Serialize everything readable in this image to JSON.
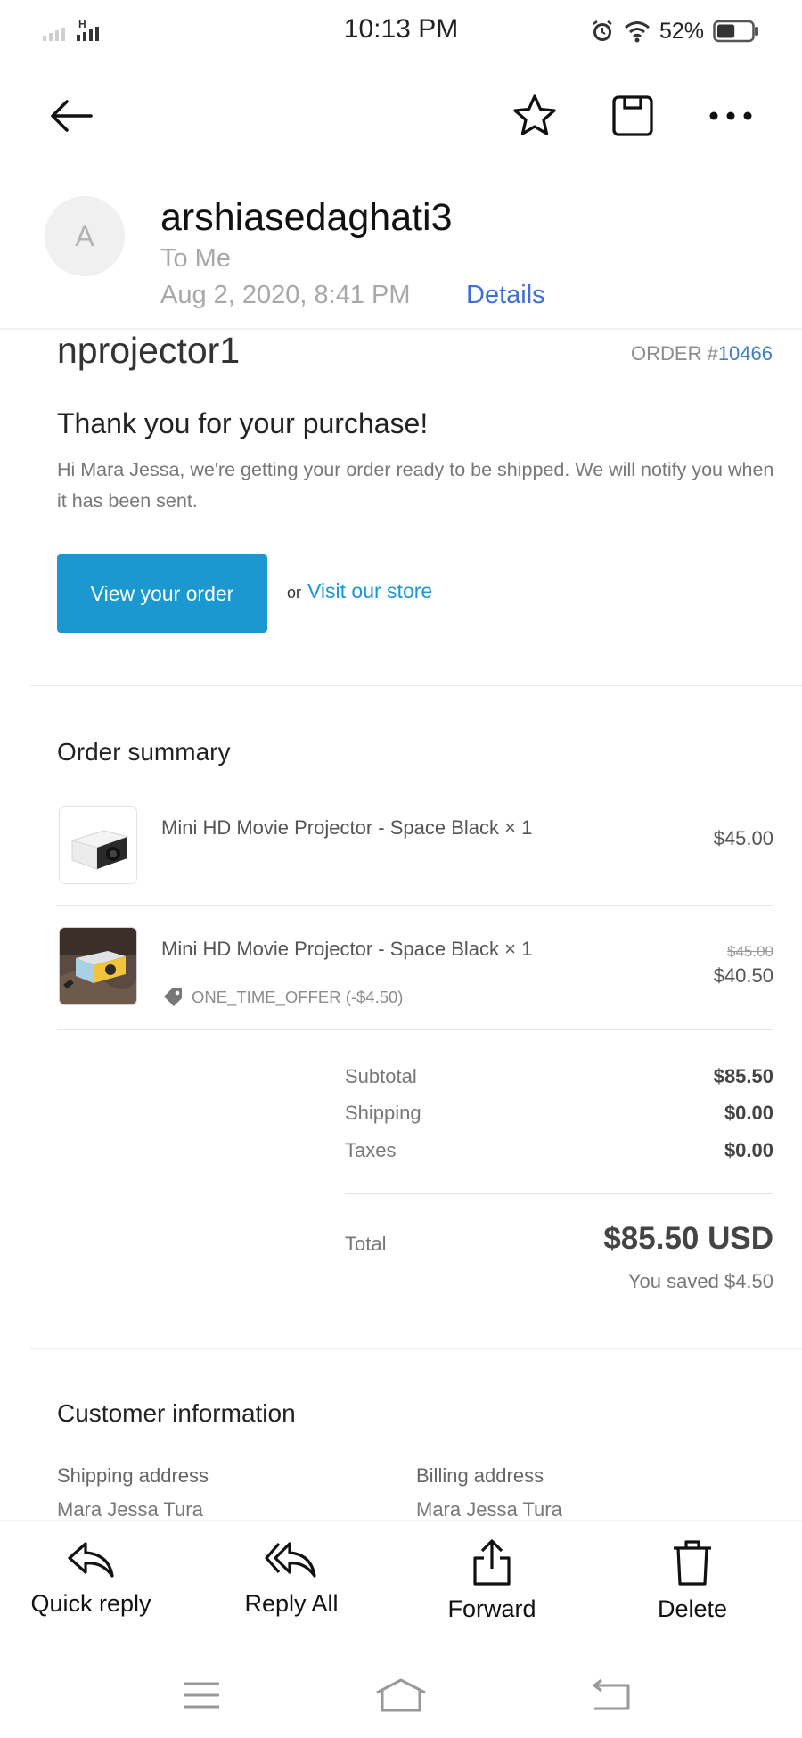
{
  "status_bar": {
    "time": "10:13 PM",
    "signal_label": "H",
    "battery_percent": "52%",
    "battery_level": 0.52
  },
  "app_bar": {
    "icons": [
      "back-arrow-icon",
      "star-icon",
      "save-icon",
      "more-icon"
    ]
  },
  "email": {
    "avatar_letter": "A",
    "sender": "arshiasedaghati3",
    "to": "To Me",
    "date": "Aug 2, 2020, 8:41 PM",
    "details_label": "Details"
  },
  "body": {
    "shop_name": "nprojector1",
    "order_prefix": "ORDER #",
    "order_number": "10466",
    "thanks_heading": "Thank you for your purchase!",
    "intro_text": "Hi Mara Jessa, we're getting your order ready to be shipped. We will notify you when it has been sent.",
    "view_order_button": "View your order",
    "or_text": "or",
    "store_link": "Visit our store",
    "order_summary": {
      "title": "Order summary",
      "items": [
        {
          "name": "Mini HD Movie Projector - Space Black × 1",
          "price": "$45.00"
        },
        {
          "name": "Mini HD Movie Projector - Space Black × 1",
          "original_price": "$45.00",
          "price": "$40.50",
          "discount": "ONE_TIME_OFFER (-$4.50)"
        }
      ],
      "subtotal_label": "Subtotal",
      "subtotal_value": "$85.50",
      "shipping_label": "Shipping",
      "shipping_value": "$0.00",
      "taxes_label": "Taxes",
      "taxes_value": "$0.00",
      "total_label": "Total",
      "total_value": "$85.50 USD",
      "saved_text": "You saved $4.50"
    },
    "customer_info": {
      "title": "Customer information",
      "shipping_label": "Shipping address",
      "shipping_name": "Mara Jessa Tura",
      "billing_label": "Billing address",
      "billing_name": "Mara Jessa Tura"
    }
  },
  "actions": {
    "quick_reply": "Quick reply",
    "reply_all": "Reply All",
    "forward": "Forward",
    "delete": "Delete"
  },
  "nav": {
    "icons": [
      "menu-icon",
      "home-icon",
      "back-icon"
    ]
  }
}
